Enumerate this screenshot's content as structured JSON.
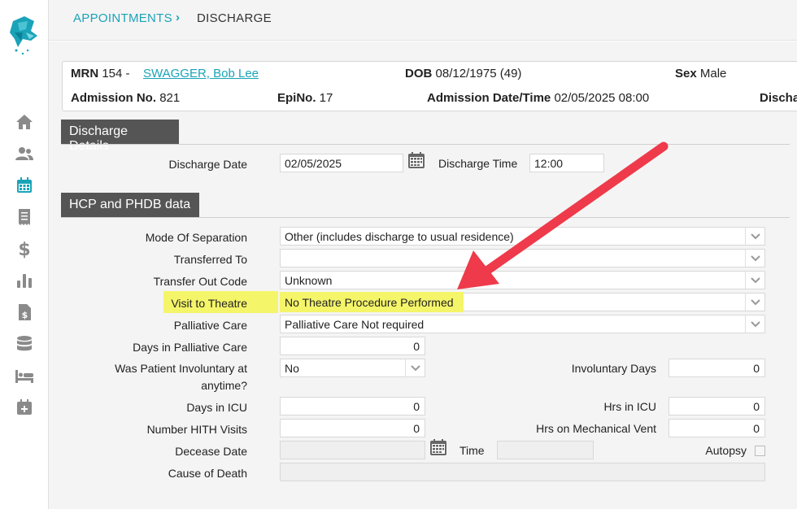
{
  "breadcrumb": {
    "parent": "APPOINTMENTS",
    "separator": "›",
    "current": "DISCHARGE"
  },
  "patient": {
    "mrn_label": "MRN",
    "mrn_value": "154 -",
    "name": "SWAGGER, Bob Lee",
    "dob_label": "DOB",
    "dob_value": "08/12/1975 (49)",
    "sex_label": "Sex",
    "sex_value": "Male",
    "admission_no_label": "Admission No.",
    "admission_no_value": "821",
    "epino_label": "EpiNo.",
    "epino_value": "17",
    "admission_dt_label": "Admission Date/Time",
    "admission_dt_value": "02/05/2025 08:00",
    "discharge_cut_label": "Discha"
  },
  "discharge_details": {
    "title": "Discharge Details",
    "date_label": "Discharge Date",
    "date_value": "02/05/2025",
    "time_label": "Discharge Time",
    "time_value": "12:00"
  },
  "hcp": {
    "title": "HCP and PHDB data",
    "mode_label": "Mode Of Separation",
    "mode_value": "Other (includes discharge to usual residence)",
    "transferred_label": "Transferred To",
    "transferred_value": "",
    "transfer_code_label": "Transfer Out Code",
    "transfer_code_value": "Unknown",
    "theatre_label": "Visit to Theatre",
    "theatre_value": "No Theatre Procedure Performed",
    "palliative_label": "Palliative Care",
    "palliative_value": "Palliative Care Not required",
    "days_palliative_label": "Days in Palliative Care",
    "days_palliative_value": "0",
    "involuntary_label_1": "Was Patient Involuntary at",
    "involuntary_label_2": "anytime?",
    "involuntary_value": "No",
    "involuntary_days_label": "Involuntary Days",
    "involuntary_days_value": "0",
    "days_icu_label": "Days in ICU",
    "days_icu_value": "0",
    "hrs_icu_label": "Hrs in ICU",
    "hrs_icu_value": "0",
    "hith_label": "Number HITH Visits",
    "hith_value": "0",
    "mech_vent_label": "Hrs on Mechanical Vent",
    "mech_vent_value": "0",
    "decease_label": "Decease Date",
    "decease_value": "",
    "time_label": "Time",
    "time_value": "",
    "autopsy_label": "Autopsy",
    "cause_label": "Cause of Death",
    "cause_value": ""
  },
  "colors": {
    "accent": "#1aa3b8",
    "section_bg": "#555555",
    "highlight": "#f5f56a",
    "arrow": "#ee3a4a"
  },
  "icons": [
    "home-icon",
    "users-icon",
    "calendar-icon",
    "receipt-icon",
    "dollar-icon",
    "bar-chart-icon",
    "invoice-icon",
    "database-icon",
    "bed-icon",
    "calendar-plus-icon"
  ]
}
